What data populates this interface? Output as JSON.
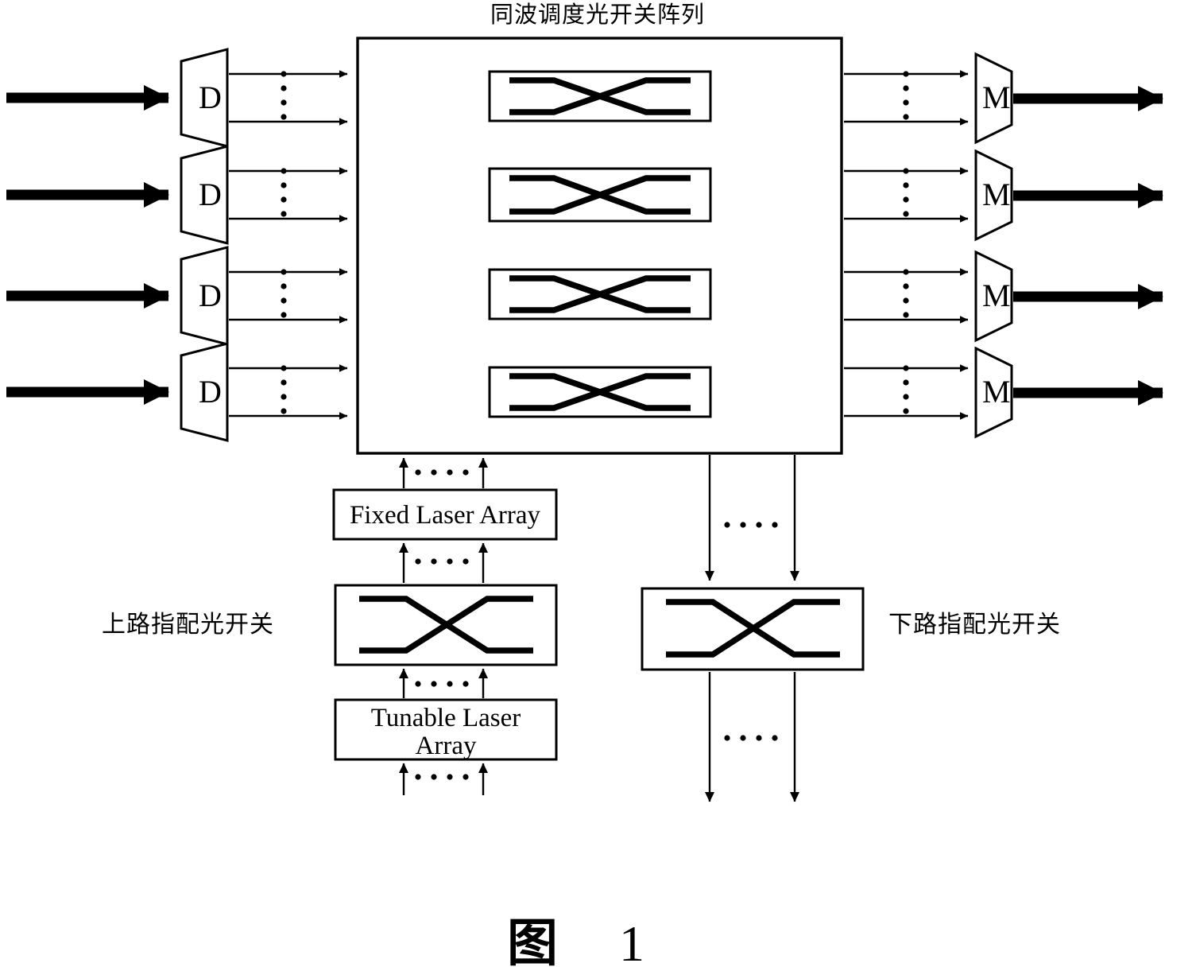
{
  "figure": {
    "title": "同波调度光开关阵列",
    "caption_cjk": "图",
    "caption_number": "1",
    "left_label": "上路指配光开关",
    "right_label": "下路指配光开关"
  },
  "boxes": {
    "fixed_laser_array": "Fixed Laser Array",
    "tunable_laser_array_line1": "Tunable Laser",
    "tunable_laser_array_line2": "Array"
  },
  "nodes": {
    "demux_letter": "D",
    "mux_letter": "M",
    "demux_count": 4,
    "mux_count": 4,
    "switch_count": 4
  },
  "colors": {
    "line": "#000000",
    "background": "#ffffff"
  }
}
